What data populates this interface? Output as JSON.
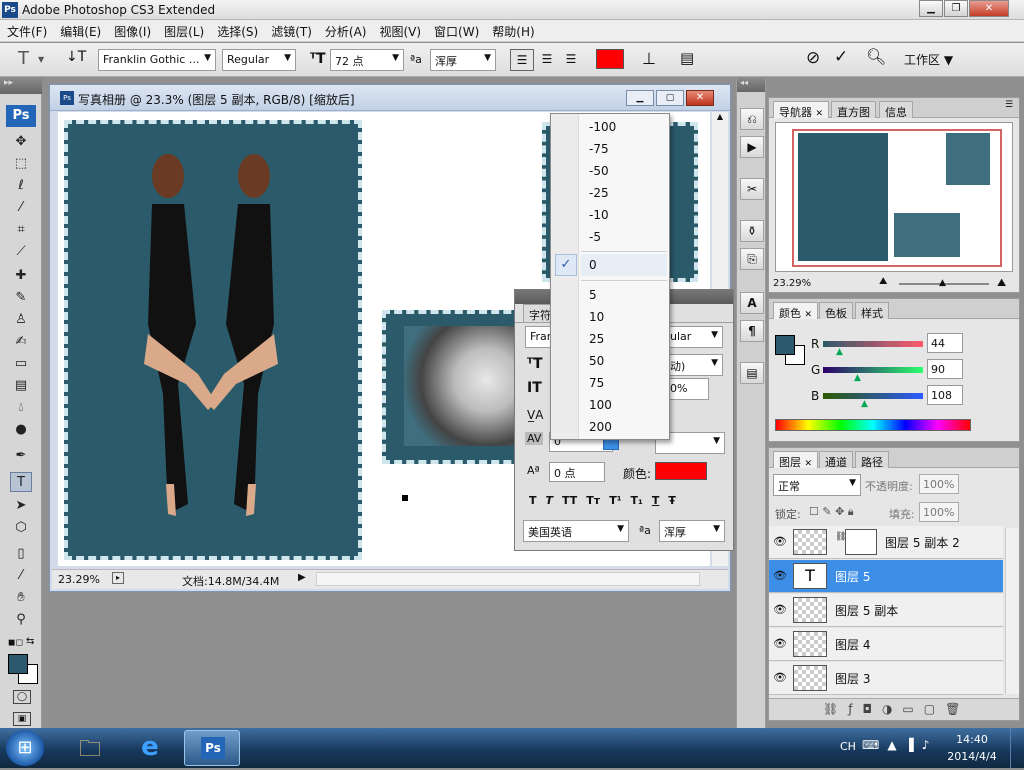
{
  "app": {
    "title": "Adobe Photoshop CS3 Extended",
    "logo": "Ps"
  },
  "menu": [
    "文件(F)",
    "编辑(E)",
    "图像(I)",
    "图层(L)",
    "选择(S)",
    "滤镜(T)",
    "分析(A)",
    "视图(V)",
    "窗口(W)",
    "帮助(H)"
  ],
  "options": {
    "font_family": "Franklin Gothic ...",
    "font_style": "Regular",
    "font_size": "72 点",
    "antialias": "浑厚",
    "text_color": "#ff0000",
    "workspace": "工作区"
  },
  "document": {
    "title": "写真相册 @ 23.3% (图层 5 副本, RGB/8) [缩放后]",
    "icon": "Ps",
    "zoom": "23.29%",
    "doc_size": "文档:14.8M/34.4M"
  },
  "tracking_menu": {
    "items_neg": [
      "-100",
      "-75",
      "-50",
      "-25",
      "-10",
      "-5"
    ],
    "checked": "0",
    "items_pos": [
      "5",
      "10",
      "25",
      "50",
      "75",
      "100",
      "200"
    ]
  },
  "character": {
    "tab": "字符",
    "font_prefix": "Fran",
    "style_suffix": "ular",
    "leading_suffix": "动)",
    "scale_suffix": "0%",
    "tracking_value": "0",
    "baseline": "0 点",
    "color_label": "颜色:",
    "color": "#ff0000",
    "format_buttons": [
      "T",
      "T",
      "TT",
      "Tт",
      "T¹",
      "T₁",
      "T",
      "Ŧ"
    ],
    "language": "美国英语",
    "antialias_label": "ªa",
    "antialias": "浑厚"
  },
  "navigator": {
    "tabs": [
      "导航器",
      "直方图",
      "信息"
    ],
    "zoom": "23.29%"
  },
  "color_panel": {
    "tabs": [
      "颜色",
      "色板",
      "样式"
    ],
    "channels": [
      {
        "label": "R",
        "value": "44",
        "position": 0.17
      },
      {
        "label": "G",
        "value": "90",
        "position": 0.35
      },
      {
        "label": "B",
        "value": "108",
        "position": 0.42
      }
    ],
    "foreground": "#2c5a6c"
  },
  "layers_panel": {
    "tabs": [
      "图层",
      "通道",
      "路径"
    ],
    "blend_mode": "正常",
    "opacity_label": "不透明度:",
    "opacity": "100%",
    "lock_label": "锁定:",
    "fill_label": "填充:",
    "fill": "100%",
    "layers": [
      "图层 5 副本 2",
      "图层 5",
      "图层 5 副本",
      "图层 4",
      "图层 3"
    ],
    "selected_index": 1
  },
  "taskbar": {
    "lang": "CH",
    "time": "14:40",
    "date": "2014/4/4",
    "ps_label": "Ps"
  }
}
